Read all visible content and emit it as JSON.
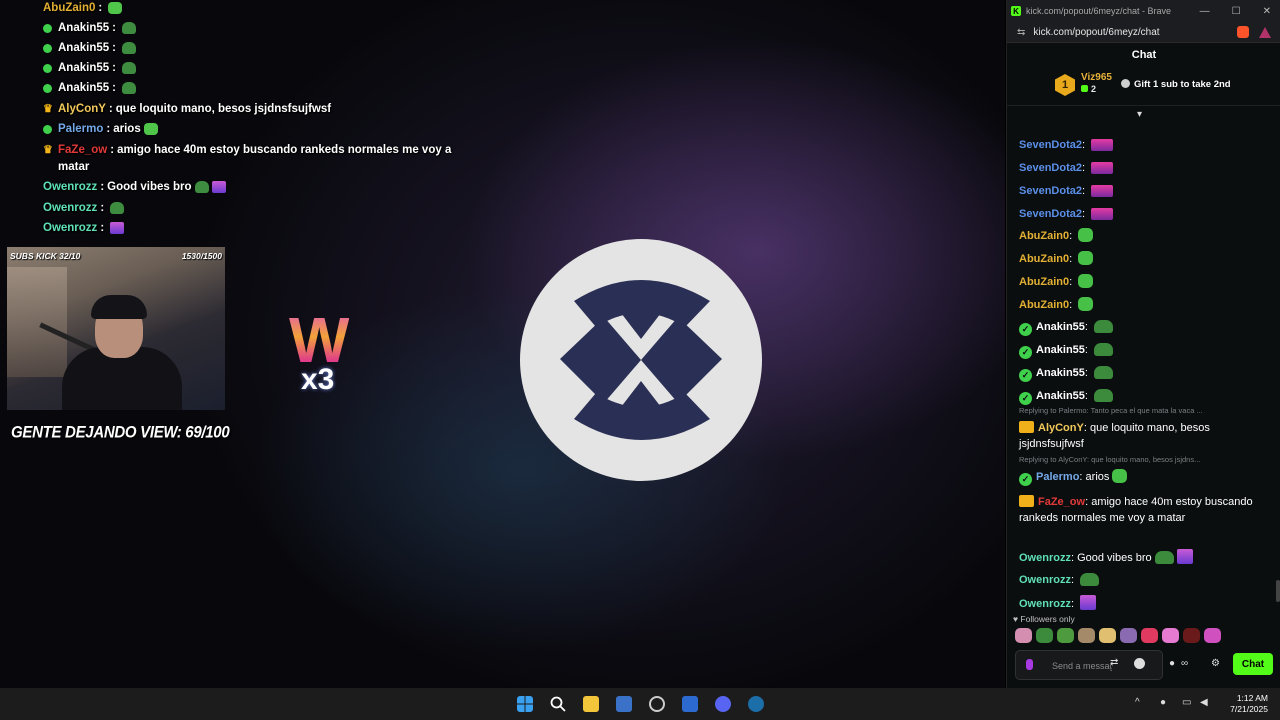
{
  "overlay_chat": [
    {
      "name": "AbuZain0",
      "sep": ":",
      "text": "",
      "badge": "none",
      "name_color": "#e3b034",
      "emote": "green"
    },
    {
      "name": "Anakin55",
      "sep": ":",
      "text": "",
      "badge": "verified",
      "name_color": "#ffffff",
      "emote": "pepe"
    },
    {
      "name": "Anakin55",
      "sep": ":",
      "text": "",
      "badge": "verified",
      "name_color": "#ffffff",
      "emote": "pepe"
    },
    {
      "name": "Anakin55",
      "sep": ":",
      "text": "",
      "badge": "verified",
      "name_color": "#ffffff",
      "emote": "pepe"
    },
    {
      "name": "Anakin55",
      "sep": ":",
      "text": "",
      "badge": "verified",
      "name_color": "#ffffff",
      "emote": "pepe"
    },
    {
      "name": "AlyConY",
      "sep": ":",
      "text": "que loquito mano, besos jsjdnsfsujfwsf",
      "badge": "crown",
      "name_color": "#f1c85a",
      "emote": ""
    },
    {
      "name": "Palermo",
      "sep": ":",
      "text": "arios",
      "badge": "verified",
      "name_color": "#74a8e8",
      "emote": "green"
    },
    {
      "name": "FaZe_ow",
      "sep": ":",
      "text": "amigo hace 40m estoy buscando rankeds normales me voy a matar",
      "badge": "crown",
      "name_color": "#e23a3a",
      "emote": ""
    },
    {
      "name": "Owenrozz",
      "sep": ":",
      "text": "Good vibes bro",
      "badge": "none",
      "name_color": "#5fe0b8",
      "emote": "pepe-purple"
    },
    {
      "name": "Owenrozz",
      "sep": ":",
      "text": "",
      "badge": "none",
      "name_color": "#5fe0b8",
      "emote": "pepe"
    },
    {
      "name": "Owenrozz",
      "sep": ":",
      "text": "",
      "badge": "none",
      "name_color": "#5fe0b8",
      "emote": "purple"
    }
  ],
  "webcam": {
    "left_label": "SUBS KICK 32/10",
    "right_label": "1530/1500"
  },
  "view_goal": "GENTE DEJANDO VIEW: 69/100",
  "w_emote": {
    "letter": "W",
    "multiplier": "x3"
  },
  "browser": {
    "tab_title": "kick.com/popout/6meyz/chat - Brave",
    "url": "kick.com/popout/6meyz/chat",
    "minimize": "—",
    "maximize": "☐",
    "close": "✕"
  },
  "chat": {
    "title": "Chat",
    "top_gifter": {
      "rank": "1",
      "name": "Viz965",
      "count": "2"
    },
    "gift_cta": "Gift 1 sub to take 2nd",
    "messages": [
      {
        "name": "SevenDota2",
        "text": "",
        "badge": "none",
        "color": "#5b8fe8",
        "emote": "pink"
      },
      {
        "name": "SevenDota2",
        "text": "",
        "badge": "none",
        "color": "#5b8fe8",
        "emote": "pink"
      },
      {
        "name": "SevenDota2",
        "text": "",
        "badge": "none",
        "color": "#5b8fe8",
        "emote": "pink"
      },
      {
        "name": "SevenDota2",
        "text": "",
        "badge": "none",
        "color": "#5b8fe8",
        "emote": "pink"
      },
      {
        "name": "AbuZain0",
        "text": "",
        "badge": "none",
        "color": "#e3b034",
        "emote": "green"
      },
      {
        "name": "AbuZain0",
        "text": "",
        "badge": "none",
        "color": "#e3b034",
        "emote": "green"
      },
      {
        "name": "AbuZain0",
        "text": "",
        "badge": "none",
        "color": "#e3b034",
        "emote": "green"
      },
      {
        "name": "AbuZain0",
        "text": "",
        "badge": "none",
        "color": "#e3b034",
        "emote": "green"
      },
      {
        "name": "Anakin55",
        "text": "",
        "badge": "verified",
        "color": "#ffffff",
        "emote": "pepe"
      },
      {
        "name": "Anakin55",
        "text": "",
        "badge": "verified",
        "color": "#ffffff",
        "emote": "pepe"
      },
      {
        "name": "Anakin55",
        "text": "",
        "badge": "verified",
        "color": "#ffffff",
        "emote": "pepe"
      },
      {
        "name": "Anakin55",
        "text": "",
        "badge": "verified",
        "color": "#ffffff",
        "emote": "pepe"
      },
      {
        "reply": "Replying to Palermo: Tanto peca el que mata la vaca ..."
      },
      {
        "name": "AlyConY",
        "text": "que loquito mano, besos jsjdnsfsujfwsf",
        "badge": "crown",
        "color": "#f1c85a",
        "emote": ""
      },
      {
        "reply": "Replying to AlyConY: que loquito mano, besos jsjdns..."
      },
      {
        "name": "Palermo",
        "text": "arios",
        "badge": "verified",
        "color": "#74a8e8",
        "emote": "green"
      },
      {
        "name": "FaZe_ow",
        "text": "amigo hace 40m estoy buscando rankeds normales me voy a matar",
        "badge": "crown",
        "color": "#e23a3a",
        "emote": ""
      },
      {
        "name": "Owenrozz",
        "text": "Good vibes bro",
        "badge": "none",
        "color": "#5fe0b8",
        "emote": "pepe-purple"
      },
      {
        "name": "Owenrozz",
        "text": "",
        "badge": "none",
        "color": "#5fe0b8",
        "emote": "pepe"
      },
      {
        "name": "Owenrozz",
        "text": "",
        "badge": "none",
        "color": "#5fe0b8",
        "emote": "purple"
      }
    ],
    "followers_only": "Followers only",
    "input_placeholder": "Send a message",
    "send_label": "Chat"
  },
  "taskbar": {
    "time": "1:12 AM",
    "date": "7/21/2025"
  },
  "colors": {
    "kick_green": "#53fc18",
    "panel_bg": "#0b0e0f"
  }
}
